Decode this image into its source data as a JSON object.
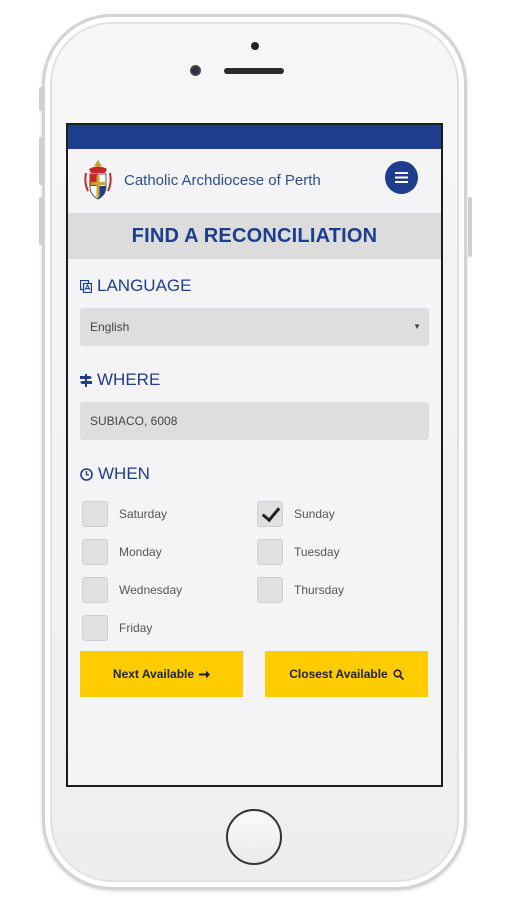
{
  "header": {
    "site_name": "Catholic Archdiocese of Perth",
    "menu_icon": "hamburger-icon",
    "brand_color": "#1d3d8e"
  },
  "page": {
    "title": "FIND A RECONCILIATION"
  },
  "language": {
    "label": "LANGUAGE",
    "icon": "language-icon",
    "selected": "English"
  },
  "where": {
    "label": "WHERE",
    "icon": "signpost-icon",
    "value": "SUBIACO, 6008"
  },
  "when": {
    "label": "WHEN",
    "icon": "clock-icon",
    "days": [
      {
        "label": "Saturday",
        "checked": false
      },
      {
        "label": "Sunday",
        "checked": true
      },
      {
        "label": "Monday",
        "checked": false
      },
      {
        "label": "Tuesday",
        "checked": false
      },
      {
        "label": "Wednesday",
        "checked": false
      },
      {
        "label": "Thursday",
        "checked": false
      },
      {
        "label": "Friday",
        "checked": false
      }
    ]
  },
  "actions": {
    "next_label": "Next Available",
    "next_icon": "arrow-right-icon",
    "closest_label": "Closest Available",
    "closest_icon": "search-icon",
    "button_color": "#ffcc00"
  }
}
